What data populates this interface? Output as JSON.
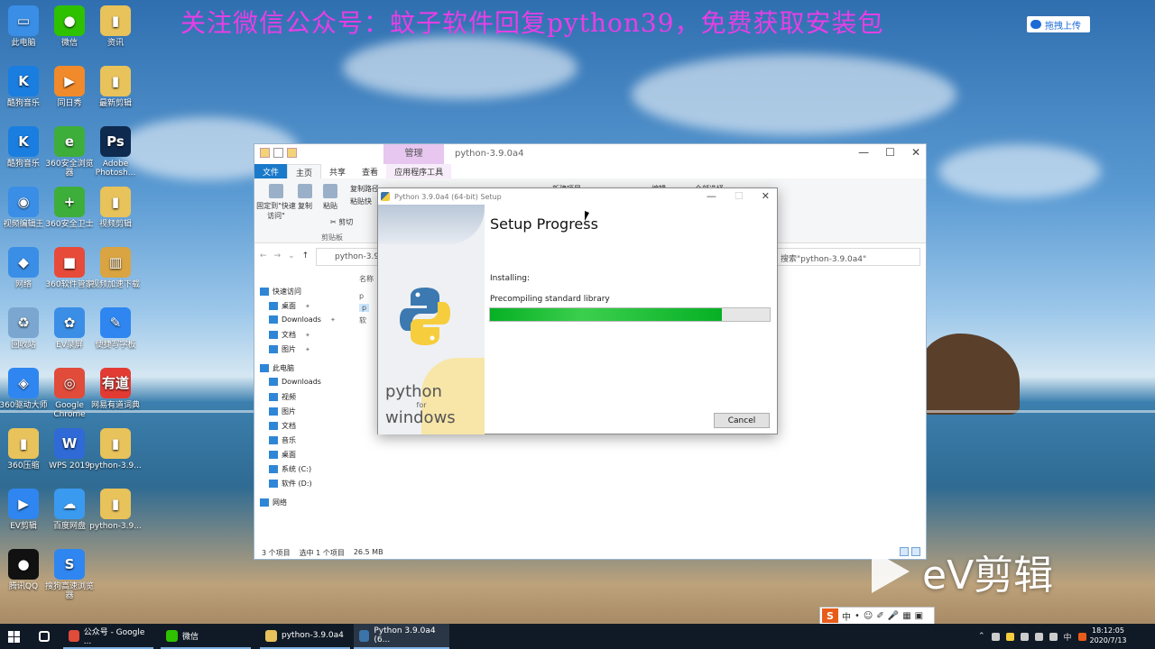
{
  "banner": {
    "text": "关注微信公众号：蚊子软件回复python39，免费获取安装包"
  },
  "upload": {
    "label": "拖拽上传"
  },
  "desktop": {
    "icons": [
      {
        "label": "此电脑",
        "color": "#3a8ee6",
        "glyph": "▭"
      },
      {
        "label": "微信",
        "color": "#2dc100",
        "glyph": "●"
      },
      {
        "label": "资讯",
        "color": "#e8c25a",
        "glyph": "▮"
      },
      {
        "label": "酷狗音乐",
        "color": "#1a7ee0",
        "glyph": "K"
      },
      {
        "label": "同日秀",
        "color": "#f08a2a",
        "glyph": "▶"
      },
      {
        "label": "最新剪辑",
        "color": "#e8c25a",
        "glyph": "▮"
      },
      {
        "label": "酷狗音乐",
        "color": "#1a7ee0",
        "glyph": "K"
      },
      {
        "label": "360安全浏览器",
        "color": "#3eae3a",
        "glyph": "e"
      },
      {
        "label": "Adobe Photosh...",
        "color": "#0e2a4f",
        "glyph": "Ps"
      },
      {
        "label": "视频编辑王",
        "color": "#3a8ee6",
        "glyph": "◉"
      },
      {
        "label": "360安全卫士",
        "color": "#3eae3a",
        "glyph": "+"
      },
      {
        "label": "视频剪辑",
        "color": "#e8c25a",
        "glyph": "▮"
      },
      {
        "label": "网络",
        "color": "#3a8ee6",
        "glyph": "◆"
      },
      {
        "label": "360软件管家",
        "color": "#e84a3a",
        "glyph": "■"
      },
      {
        "label": "视频加速下载",
        "color": "#d9a441",
        "glyph": "▥"
      },
      {
        "label": "回收站",
        "color": "#7aa6cf",
        "glyph": "♻"
      },
      {
        "label": "EV录屏",
        "color": "#3a8ee6",
        "glyph": "✿"
      },
      {
        "label": "便捷写字板",
        "color": "#2f86f0",
        "glyph": "✎"
      },
      {
        "label": "360驱动大师",
        "color": "#2f86f0",
        "glyph": "◈"
      },
      {
        "label": "Google Chrome",
        "color": "#e04b3a",
        "glyph": "◎"
      },
      {
        "label": "网易有道词典",
        "color": "#e23b33",
        "glyph": "有道"
      },
      {
        "label": "360压缩",
        "color": "#e8c25a",
        "glyph": "▮"
      },
      {
        "label": "WPS 2019",
        "color": "#2f6ad6",
        "glyph": "W"
      },
      {
        "label": "python-3.9...",
        "color": "#e8c25a",
        "glyph": "▮"
      },
      {
        "label": "EV剪辑",
        "color": "#2f86f0",
        "glyph": "▶"
      },
      {
        "label": "百度网盘",
        "color": "#3a9af0",
        "glyph": "☁"
      },
      {
        "label": "python-3.9...",
        "color": "#e8c25a",
        "glyph": "▮"
      },
      {
        "label": "腾讯QQ",
        "color": "#111111",
        "glyph": "●"
      },
      {
        "label": "搜狗高速浏览器",
        "color": "#2f86f0",
        "glyph": "S"
      }
    ]
  },
  "explorer": {
    "title": "python-3.9.0a4",
    "ctx_tool_label": "管理",
    "tabs": [
      "文件",
      "主页",
      "共享",
      "查看",
      "应用程序工具"
    ],
    "ribbon": {
      "pin_label": "固定到\"快速访问\"",
      "copy_label": "复制",
      "paste_label": "粘贴",
      "copy_path_label": "复制路径",
      "paste_shortcut_label": "粘贴快",
      "cut_label": "剪切",
      "clipboard_group": "剪贴板",
      "new_item_label": "新建项目",
      "open_label": "编辑",
      "select_all_label": "全部选择"
    },
    "address": "python-3.9",
    "search_placeholder": "搜索\"python-3.9.0a4\"",
    "column_header": "名称",
    "files": [
      "p",
      "p",
      "软"
    ],
    "nav": [
      {
        "label": "快速访问",
        "type": "head"
      },
      {
        "label": "桌面",
        "type": "blue",
        "pinned": true
      },
      {
        "label": "Downloads",
        "type": "blue",
        "pinned": true
      },
      {
        "label": "文档",
        "type": "blue",
        "pinned": true
      },
      {
        "label": "图片",
        "type": "blue",
        "pinned": true
      },
      {
        "label": "此电脑",
        "type": "head"
      },
      {
        "label": "Downloads",
        "type": "blue"
      },
      {
        "label": "视频",
        "type": "blue"
      },
      {
        "label": "图片",
        "type": "blue"
      },
      {
        "label": "文档",
        "type": "blue"
      },
      {
        "label": "音乐",
        "type": "blue"
      },
      {
        "label": "桌面",
        "type": "blue"
      },
      {
        "label": "系统 (C:)",
        "type": "blue"
      },
      {
        "label": "软件 (D:)",
        "type": "blue"
      },
      {
        "label": "网络",
        "type": "head"
      }
    ],
    "status": {
      "count": "3 个项目",
      "selected": "选中 1 个项目",
      "size": "26.5 MB"
    }
  },
  "setup": {
    "title": "Python 3.9.0a4 (64-bit) Setup",
    "heading": "Setup Progress",
    "installing": "Installing:",
    "step": "Precompiling standard library",
    "progress": 0.83,
    "cancel": "Cancel",
    "brand_top": "python",
    "brand_for": "for",
    "brand_bottom": "windows"
  },
  "watermark": {
    "text": "eV剪辑"
  },
  "ime": {
    "lang": "中",
    "items": [
      "•",
      "☺",
      "✐",
      "🎤",
      "▦",
      "▣"
    ]
  },
  "taskbar": {
    "apps": [
      {
        "label": "公众号 - Google ...",
        "color": "#e04b3a"
      },
      {
        "label": "微信",
        "color": "#2dc100"
      },
      {
        "label": "python-3.9.0a4",
        "color": "#e8c25a"
      },
      {
        "label": "Python 3.9.0a4 (6...",
        "color": "#3a74a8"
      }
    ],
    "tray_lang": "中",
    "time": "18:12:05",
    "date": "2020/7/13"
  }
}
